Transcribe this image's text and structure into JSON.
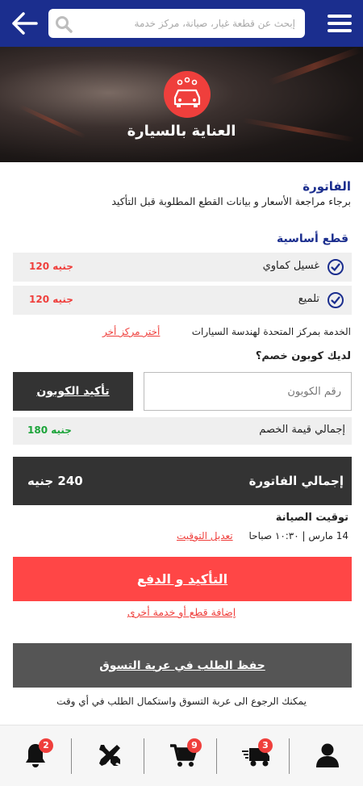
{
  "header": {
    "search_placeholder": "إبحث عن قطعة غيار، صيانة، مركز خدمة",
    "icons": [
      "menu-icon",
      "search-icon",
      "back-arrow-icon"
    ]
  },
  "hero": {
    "title": "العناية بالسيارة",
    "icon": "car-wash-icon"
  },
  "invoice": {
    "title": "الفاتورة",
    "subtitle": "برجاء مراجعة الأسعار و بيانات القطع المطلوبة قبل التأكيد"
  },
  "parts": {
    "heading": "قطع أساسية",
    "items": [
      {
        "name": "غسيل كماوي",
        "price": "120 جنيه"
      },
      {
        "name": "تلميع",
        "price": "120 جنيه"
      }
    ]
  },
  "service": {
    "center_text": "الخدمة بمركز المتحدة لهندسة السيارات",
    "change_link": "أختر مركز أخر"
  },
  "coupon": {
    "question": "لديك كوبون خصم؟",
    "placeholder": "رقم الكوبون",
    "confirm_label": "تأكيد الكوبون"
  },
  "discount": {
    "label": "إجمالي قيمة الخصم",
    "value": "180 جنيه"
  },
  "total": {
    "label": "إجمالي الفاتورة",
    "value": "240 جنيه"
  },
  "maintenance": {
    "title": "توقيت الصيانة",
    "datetime": "14 مارس | ١٠:٣٠ صباحا",
    "edit_link": "تعديل التوقيت"
  },
  "actions": {
    "confirm_pay": "التأكيد و الدفع",
    "add_more": "إضافة قطع أو خدمة أخرى",
    "save_cart": "حفظ الطلب في عربة التسوق",
    "cart_note": "يمكنك الرجوع الى عربة التسوق واستكمال الطلب في أي وقت"
  },
  "tabbar": {
    "items": [
      {
        "icon": "bell-icon",
        "badge": "2"
      },
      {
        "icon": "tools-icon",
        "badge": ""
      },
      {
        "icon": "cart-icon",
        "badge": "9"
      },
      {
        "icon": "delivery-truck-icon",
        "badge": "3"
      },
      {
        "icon": "user-icon",
        "badge": ""
      }
    ]
  },
  "colors": {
    "primary": "#1b2e8e",
    "accent": "#ef3f3c",
    "success": "#1ca43a",
    "dark": "#333333"
  }
}
